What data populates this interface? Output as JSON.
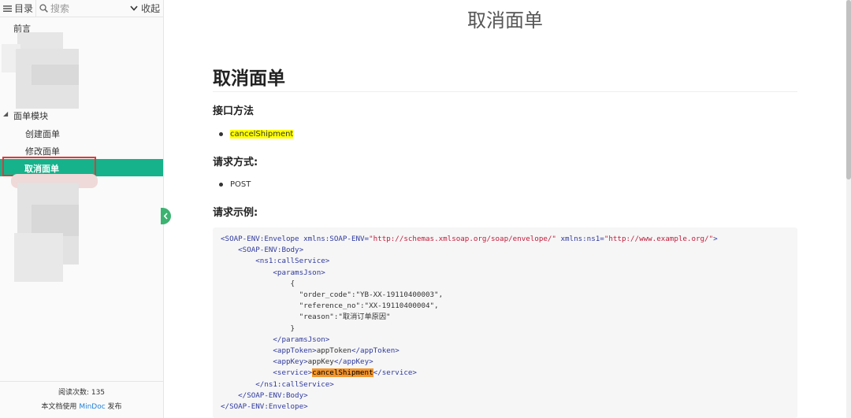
{
  "sidebar": {
    "catalog_label": "目录",
    "search_placeholder": "搜索",
    "collapse_label": "收起",
    "items": {
      "preface": "前言",
      "module": "面单模块",
      "create": "创建面单",
      "modify": "修改面单",
      "cancel": "取消面单"
    },
    "footer": {
      "reads_label": "阅读次数:",
      "reads_count": "135",
      "publish_prefix": "本文档使用",
      "publish_link": "MinDoc",
      "publish_suffix": "发布"
    }
  },
  "content": {
    "page_title": "取消面单",
    "heading": "取消面单",
    "sections": {
      "method_title": "接口方法",
      "method_value": "cancelShipment",
      "request_type_title": "请求方式:",
      "request_type_value": "POST",
      "example_title": "请求示例:"
    },
    "code": {
      "l1_open": "<SOAP-ENV:Envelope",
      "l1_attr1": " xmlns:SOAP-ENV=",
      "l1_val1": "\"http://schemas.xmlsoap.org/soap/envelope/\"",
      "l1_attr2": " xmlns:ns1=",
      "l1_val2": "\"http://www.example.org/\"",
      "l1_close": ">",
      "l2": "    <SOAP-ENV:Body>",
      "l3": "        <ns1:callService>",
      "l4": "            <paramsJson>",
      "l5": "                {",
      "l6_key": "                  \"order_code\"",
      "l6_val": ":\"YB-XX-19110400003\",",
      "l7_key": "                  \"reference_no\"",
      "l7_val": ":\"XX-19110400004\",",
      "l8_key": "                  \"reason\"",
      "l8_val": ":\"取消订单原因\"",
      "l9": "                }",
      "l10": "            </paramsJson>",
      "l11_open": "            <appToken>",
      "l11_text": "appToken",
      "l11_close": "</appToken>",
      "l12_open": "            <appKey>",
      "l12_text": "appKey",
      "l12_close": "</appKey>",
      "l13_open": "            <service>",
      "l13_text": "cancelShipment",
      "l13_close": "</service>",
      "l14": "        </ns1:callService>",
      "l15": "    </SOAP-ENV:Body>",
      "l16": "</SOAP-ENV:Envelope>"
    }
  },
  "colors": {
    "active_bg": "#16b28b",
    "active_outline": "#e03a3a",
    "highlight": "#ffff00",
    "code_highlight": "#f5962d",
    "link": "#1e80d8"
  }
}
